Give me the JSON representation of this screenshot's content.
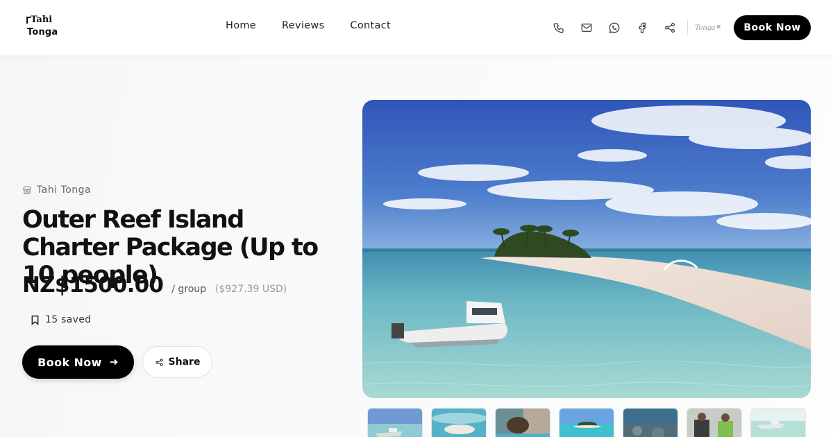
{
  "brand": {
    "logo_line1": "Tahi",
    "logo_line2": "Tonga"
  },
  "nav": {
    "items": [
      "Home",
      "Reviews",
      "Contact"
    ]
  },
  "header_icons": [
    "phone-icon",
    "mail-icon",
    "whatsapp-icon",
    "facebook-icon",
    "share-icon"
  ],
  "partner_logo": {
    "text": "Tonga"
  },
  "header_cta": "Book Now",
  "listing": {
    "vendor": "Tahi Tonga",
    "title": "Outer Reef Island Charter Package (Up to 10 people)",
    "price": "NZ$1500.00",
    "unit": "/ group",
    "converted": "($927.39 USD)",
    "saved": "15 saved",
    "book_label": "Book Now",
    "share_label": "Share"
  },
  "gallery": {
    "thumbnail_count": 7
  },
  "colors": {
    "primary": "#000000",
    "muted_text": "#666666",
    "background": "#f7f9fa"
  }
}
